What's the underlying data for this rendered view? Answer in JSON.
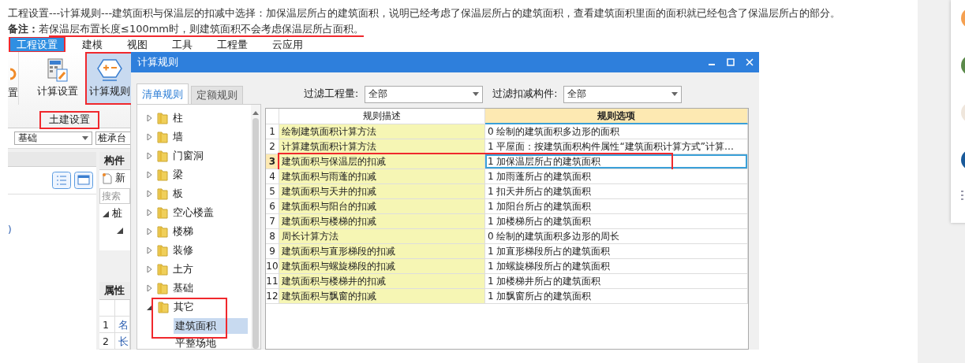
{
  "article": {
    "paragraph": "工程设置---计算规则---建筑面积与保温层的扣减中选择：加保温层所占的建筑面积，说明已经考虑了保温层所占的建筑面积，查看建筑面积里面的面积就已经包含了保温层所占的部分。",
    "note": {
      "lead": "**备注：**若",
      "underlined": "保温层布置长度≤100mm时，则建筑面积不会考虑保温层所占面积。"
    }
  },
  "app": {
    "menu": [
      {
        "label": "工程设置",
        "selected": true,
        "annotated": true
      },
      {
        "label": "建模",
        "selected": false,
        "annotated": false
      },
      {
        "label": "视图",
        "selected": false,
        "annotated": false
      },
      {
        "label": "工具",
        "selected": false,
        "annotated": false
      },
      {
        "label": "工程量",
        "selected": false,
        "annotated": false
      },
      {
        "label": "云应用",
        "selected": false,
        "annotated": false
      }
    ],
    "ribbon": {
      "buttons": [
        {
          "label": "置",
          "kind": "gear"
        },
        {
          "label": "计算设置",
          "kind": "calculator",
          "selected": false,
          "annotated": false
        },
        {
          "label": "计算规则",
          "kind": "rules",
          "selected": true,
          "annotated": true
        }
      ],
      "group_label": "土建设置",
      "group_annotated": true
    },
    "toolbar": {
      "floor_select": "基础",
      "component_select": "桩承台"
    },
    "left_fragment": ")",
    "component_panel": {
      "title": "构件",
      "new_button": "新",
      "search_placeholder": "搜索",
      "tree_label": "桩"
    },
    "property_panel": {
      "title": "属性",
      "rows": [
        {
          "number": "1",
          "name": "名"
        },
        {
          "number": "2",
          "name": "长"
        }
      ]
    }
  },
  "dialog": {
    "title": "计算规则",
    "tabs": [
      {
        "label": "清单规则",
        "selected": true
      },
      {
        "label": "定额规则",
        "selected": false
      }
    ],
    "tree": [
      {
        "label": "柱",
        "expanded": false,
        "annotated": false
      },
      {
        "label": "墙",
        "expanded": false,
        "annotated": false
      },
      {
        "label": "门窗洞",
        "expanded": false,
        "annotated": false
      },
      {
        "label": "梁",
        "expanded": false,
        "annotated": false
      },
      {
        "label": "板",
        "expanded": false,
        "annotated": false
      },
      {
        "label": "空心楼盖",
        "expanded": false,
        "annotated": false
      },
      {
        "label": "楼梯",
        "expanded": false,
        "annotated": false
      },
      {
        "label": "装修",
        "expanded": false,
        "annotated": false
      },
      {
        "label": "土方",
        "expanded": false,
        "annotated": false
      },
      {
        "label": "基础",
        "expanded": false,
        "annotated": false
      },
      {
        "label": "其它",
        "expanded": true,
        "annotated": true,
        "children": [
          {
            "label": "建筑面积",
            "selected": true
          },
          {
            "label": "平整场地",
            "selected": false
          }
        ]
      }
    ],
    "filters": [
      {
        "label": "过滤工程量:",
        "value": "全部"
      },
      {
        "label": "过滤扣减构件:",
        "value": "全部"
      }
    ],
    "table": {
      "columns": [
        "规则描述",
        "规则选项"
      ],
      "rows": [
        {
          "number": "1",
          "description": "绘制建筑面积计算方法",
          "option": "0  绘制的建筑面积多边形的面积",
          "selected": false,
          "annotated": false
        },
        {
          "number": "2",
          "description": "计算建筑面积计算方法",
          "option": "1  平屋面：按建筑面积构件属性“建筑面积计算方式”计算…",
          "selected": false,
          "annotated": false
        },
        {
          "number": "3",
          "description": "建筑面积与保温层的扣减",
          "option": "1  加保温层所占的建筑面积",
          "selected": true,
          "annotated": true
        },
        {
          "number": "4",
          "description": "建筑面积与雨蓬的扣减",
          "option": "1  加雨蓬所占的建筑面积",
          "selected": false,
          "annotated": false
        },
        {
          "number": "5",
          "description": "建筑面积与天井的扣减",
          "option": "1  扣天井所占的建筑面积",
          "selected": false,
          "annotated": false
        },
        {
          "number": "6",
          "description": "建筑面积与阳台的扣减",
          "option": "1  加阳台所占的建筑面积",
          "selected": false,
          "annotated": false
        },
        {
          "number": "7",
          "description": "建筑面积与楼梯的扣减",
          "option": "1  加楼梯所占的建筑面积",
          "selected": false,
          "annotated": false
        },
        {
          "number": "8",
          "description": "周长计算方法",
          "option": "0  绘制的建筑面积多边形的周长",
          "selected": false,
          "annotated": false
        },
        {
          "number": "9",
          "description": "建筑面积与直形梯段的扣减",
          "option": "1  加直形梯段所占的建筑面积",
          "selected": false,
          "annotated": false
        },
        {
          "number": "10",
          "description": "建筑面积与螺旋梯段的扣减",
          "option": "1  加螺旋梯段所占的建筑面积",
          "selected": false,
          "annotated": false
        },
        {
          "number": "11",
          "description": "建筑面积与楼梯井的扣减",
          "option": "1  加楼梯井所占的建筑面积",
          "selected": false,
          "annotated": false
        },
        {
          "number": "12",
          "description": "建筑面积与飘窗的扣减",
          "option": "1  加飘窗所占的建筑面积",
          "selected": false,
          "annotated": false
        }
      ]
    }
  }
}
